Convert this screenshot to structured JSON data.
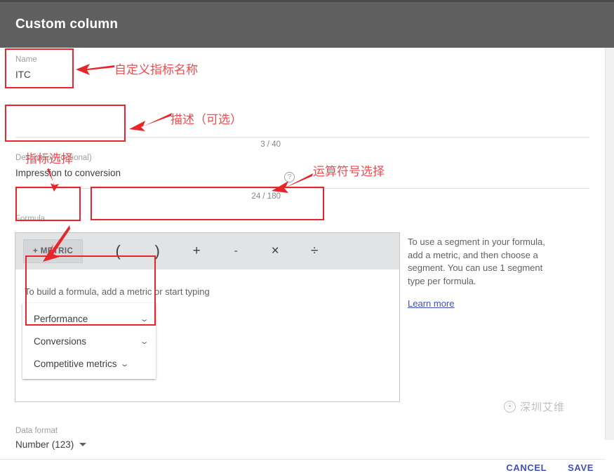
{
  "header": {
    "title": "Custom column"
  },
  "fields": {
    "name": {
      "label": "Name",
      "value": "ITC",
      "counter": "3 / 40"
    },
    "description": {
      "label": "Description (optional)",
      "value": "Impression to conversion",
      "counter": "24 / 180",
      "help_icon": "help-circle-icon"
    },
    "formula": {
      "label": "Formula",
      "metric_button": "+ METRIC",
      "operators": [
        {
          "name": "paren-open",
          "glyph": "("
        },
        {
          "name": "paren-close",
          "glyph": ")"
        },
        {
          "name": "plus",
          "glyph": "+"
        },
        {
          "name": "minus",
          "glyph": "-"
        },
        {
          "name": "multiply",
          "glyph": "×"
        },
        {
          "name": "divide",
          "glyph": "÷"
        }
      ],
      "hint": "To build a formula, add a metric or start typing",
      "metric_categories": [
        {
          "label": "Performance",
          "caret": "chevron-down-icon"
        },
        {
          "label": "Conversions",
          "caret": "chevron-down-icon"
        },
        {
          "label": "Competitive metrics",
          "caret": "chevron-down-icon"
        }
      ]
    },
    "data_format": {
      "label": "Data format",
      "value": "Number (123)",
      "caret": "caret-down-icon"
    }
  },
  "side_help": {
    "text": "To use a segment in your formula, add a metric, and then choose a segment. You can use 1 segment type per formula.",
    "link": "Learn more"
  },
  "footer": {
    "cancel": "CANCEL",
    "save": "SAVE"
  },
  "watermark": {
    "text": "深圳艾维",
    "logo": "circle-logo-icon"
  },
  "annotations": [
    {
      "id": "name-anno",
      "text": "自定义指标名称"
    },
    {
      "id": "desc-anno",
      "text": "描述（可选）"
    },
    {
      "id": "metric-anno",
      "text": "指标选择"
    },
    {
      "id": "operator-anno",
      "text": "运算符号选择"
    }
  ],
  "colors": {
    "header_bg": "#5f5f5f",
    "accent_link": "#3f51b5",
    "annotation_red": "#e8252a",
    "annotation_text": "#ef4b50",
    "toolbar_bg": "#e2e3e5"
  }
}
